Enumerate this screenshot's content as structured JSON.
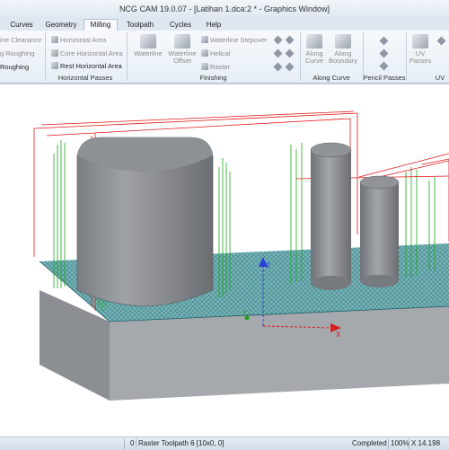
{
  "window": {
    "title": "NCG CAM 19.0.07 - [Latihan 1.dca:2 * - Graphics Window]"
  },
  "tabs": [
    "Curves",
    "Geometry",
    "Milling",
    "Toolpath",
    "Cycles",
    "Help"
  ],
  "active_tab": "Milling",
  "ribbon": {
    "roughing": {
      "items": [
        "ine Clearance",
        "g Roughing",
        "Roughing"
      ]
    },
    "horizontal_passes": {
      "label": "Horizontal Passes",
      "items": [
        "Horizontal Area",
        "Core Horizontal Area",
        "Rest Horizontal Area"
      ]
    },
    "finishing": {
      "label": "Finishing",
      "waterline": "Waterline",
      "waterline_offset": "Waterline Offset",
      "items": [
        "Waterline Stepover",
        "Helical",
        "Raster"
      ]
    },
    "along_curve": {
      "label": "Along Curve",
      "along_curve": "Along Curve",
      "along_boundary": "Along Boundary"
    },
    "pencil_passes": {
      "label": "Pencil Passes"
    },
    "uv": {
      "label": "UV",
      "uv_passes": "UV Passes"
    }
  },
  "statusbar": {
    "count": "0",
    "toolpath": "Raster Toolpath 6 [10x0, 0]",
    "state": "Completed",
    "zoom": "100%",
    "coord": "X 14.198"
  },
  "colors": {
    "toolpath_red": "#e11818",
    "toolpath_green": "#1aa81a",
    "raster_teal": "#2b8a8f",
    "axis_blue": "#2a3fd6",
    "axis_red": "#d81f1f",
    "axis_green": "#1ca21c"
  }
}
